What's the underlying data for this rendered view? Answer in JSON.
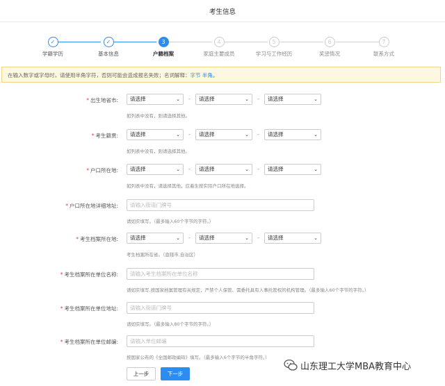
{
  "header": {
    "title": "考生信息"
  },
  "steps": [
    {
      "label": "学籍学历",
      "number": "✓",
      "state": "done"
    },
    {
      "label": "基本信息",
      "number": "✓",
      "state": "done"
    },
    {
      "label": "户籍档案",
      "number": "3",
      "state": "active"
    },
    {
      "label": "家庭主要成员",
      "number": "4",
      "state": "todo"
    },
    {
      "label": "学习与工作经历",
      "number": "5",
      "state": "todo"
    },
    {
      "label": "奖惩情况",
      "number": "6",
      "state": "todo"
    },
    {
      "label": "联系方式",
      "number": "7",
      "state": "todo"
    }
  ],
  "notice": {
    "text": "在输入数字或字母时，请使用半角字符，否则可能会造成报名失败；名词解释：",
    "link_byte": "字节",
    "link_halfwidth": "半角",
    "suffix": "。"
  },
  "select_placeholder": "请选择",
  "dash": "-",
  "form": {
    "birthplace": {
      "label": "出生地省市:",
      "hint": "如列表中没有，则请选择其他。"
    },
    "native": {
      "label": "考生籍贯:",
      "hint": "如列表中没有，则请选择其他。"
    },
    "hukou": {
      "label": "户口所在地:",
      "hint": "如列表中没有，请选择其他，应着生按实际户口所在地选择。"
    },
    "hukou_address": {
      "label": "户口所在地详细地址:",
      "placeholder": "请输入街道门牌号",
      "hint": "请如实填写。（最多输入60个字节的字符。）"
    },
    "archive_location": {
      "label": "考生档案所在地:",
      "hint": "考生档案所在省。（直辖市,自治区）"
    },
    "archive_unit_name": {
      "label": "考生档案所在单位名称:",
      "placeholder": "请输入考生档案所在单位名称",
      "hint": "请如实填写,按国家档案管理有关规定，严禁个人保管、需委托具有人事托管权的机构管理。（最多输入60个字节的字符。）"
    },
    "archive_unit_address": {
      "label": "考生档案所在单位地址:",
      "placeholder": "请输入街道门牌号",
      "hint": "请如实填写。（最多输入80个字节的字符。）"
    },
    "archive_unit_zip": {
      "label": "考生档案所在单位邮编:",
      "placeholder": "请输入单位邮编",
      "hint": "按国家公布的《全国邮政编码》填写。（最多输入6个字节的半角字符。）"
    }
  },
  "buttons": {
    "prev": "上一步",
    "next": "下一步"
  },
  "watermark": {
    "text": "山东理工大学MBA教育中心"
  },
  "colors": {
    "primary": "#2d8cf0",
    "required": "#e4393c",
    "notice_bg": "#fff8e1"
  }
}
